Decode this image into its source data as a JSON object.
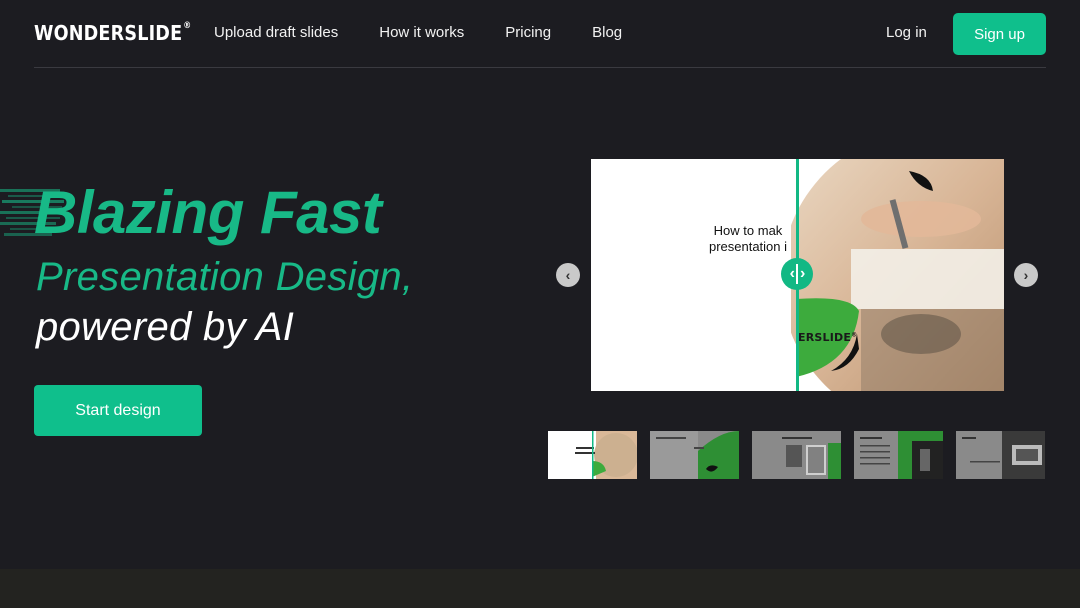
{
  "brand": {
    "name": "WONDERSLIDE",
    "mark": "®"
  },
  "nav": {
    "items": [
      "Upload draft slides",
      "How it works",
      "Pricing",
      "Blog"
    ],
    "login": "Log in",
    "signup": "Sign up"
  },
  "hero": {
    "headline": "Blazing Fast",
    "subheadline": "Presentation Design,",
    "tagline": "powered by AI",
    "cta": "Start design"
  },
  "preview": {
    "slide_title_line1": "How to mak",
    "slide_title_line2": "presentation i",
    "slide_brand": "ERSLIDE",
    "slide_brand_mark": "®",
    "prev_icon": "‹",
    "next_icon": "›"
  },
  "colors": {
    "accent": "#0fbf8c",
    "background": "#1c1c21",
    "text": "#ffffff"
  }
}
